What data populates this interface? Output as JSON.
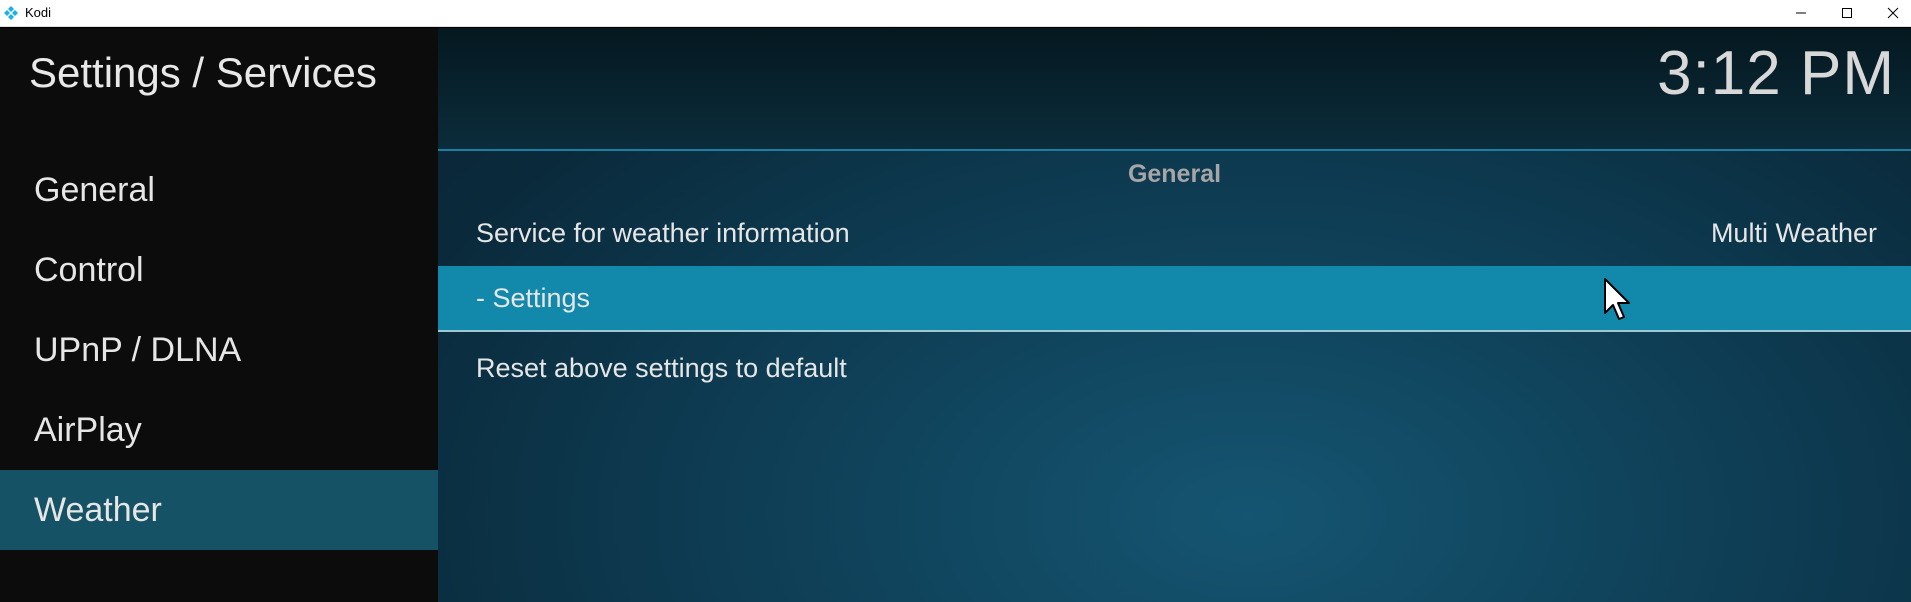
{
  "window": {
    "title": "Kodi",
    "controls": [
      "minimize",
      "maximize",
      "close"
    ]
  },
  "header": {
    "page_title": "Settings / Services",
    "clock": "3:12 PM"
  },
  "sidebar": {
    "items": [
      {
        "label": "General",
        "active": false
      },
      {
        "label": "Control",
        "active": false
      },
      {
        "label": "UPnP / DLNA",
        "active": false
      },
      {
        "label": "AirPlay",
        "active": false
      },
      {
        "label": "Weather",
        "active": true
      }
    ]
  },
  "settings": {
    "group_title": "General",
    "rows": [
      {
        "label": "Service for weather information",
        "value": "Multi Weather",
        "focused": false
      },
      {
        "label": "- Settings",
        "value": "",
        "focused": true
      },
      {
        "label": "Reset above settings to default",
        "value": "",
        "focused": false
      }
    ]
  },
  "colors": {
    "sidebar_bg": "#0c0c0c",
    "sidebar_active": "#155266",
    "focused_row": "#1288aa",
    "accent_line": "#1a7fa3",
    "content_bg": "#0e3d54"
  },
  "icons": [
    "kodi-logo-icon",
    "minimize-icon",
    "maximize-icon",
    "close-icon",
    "mouse-cursor-icon"
  ]
}
